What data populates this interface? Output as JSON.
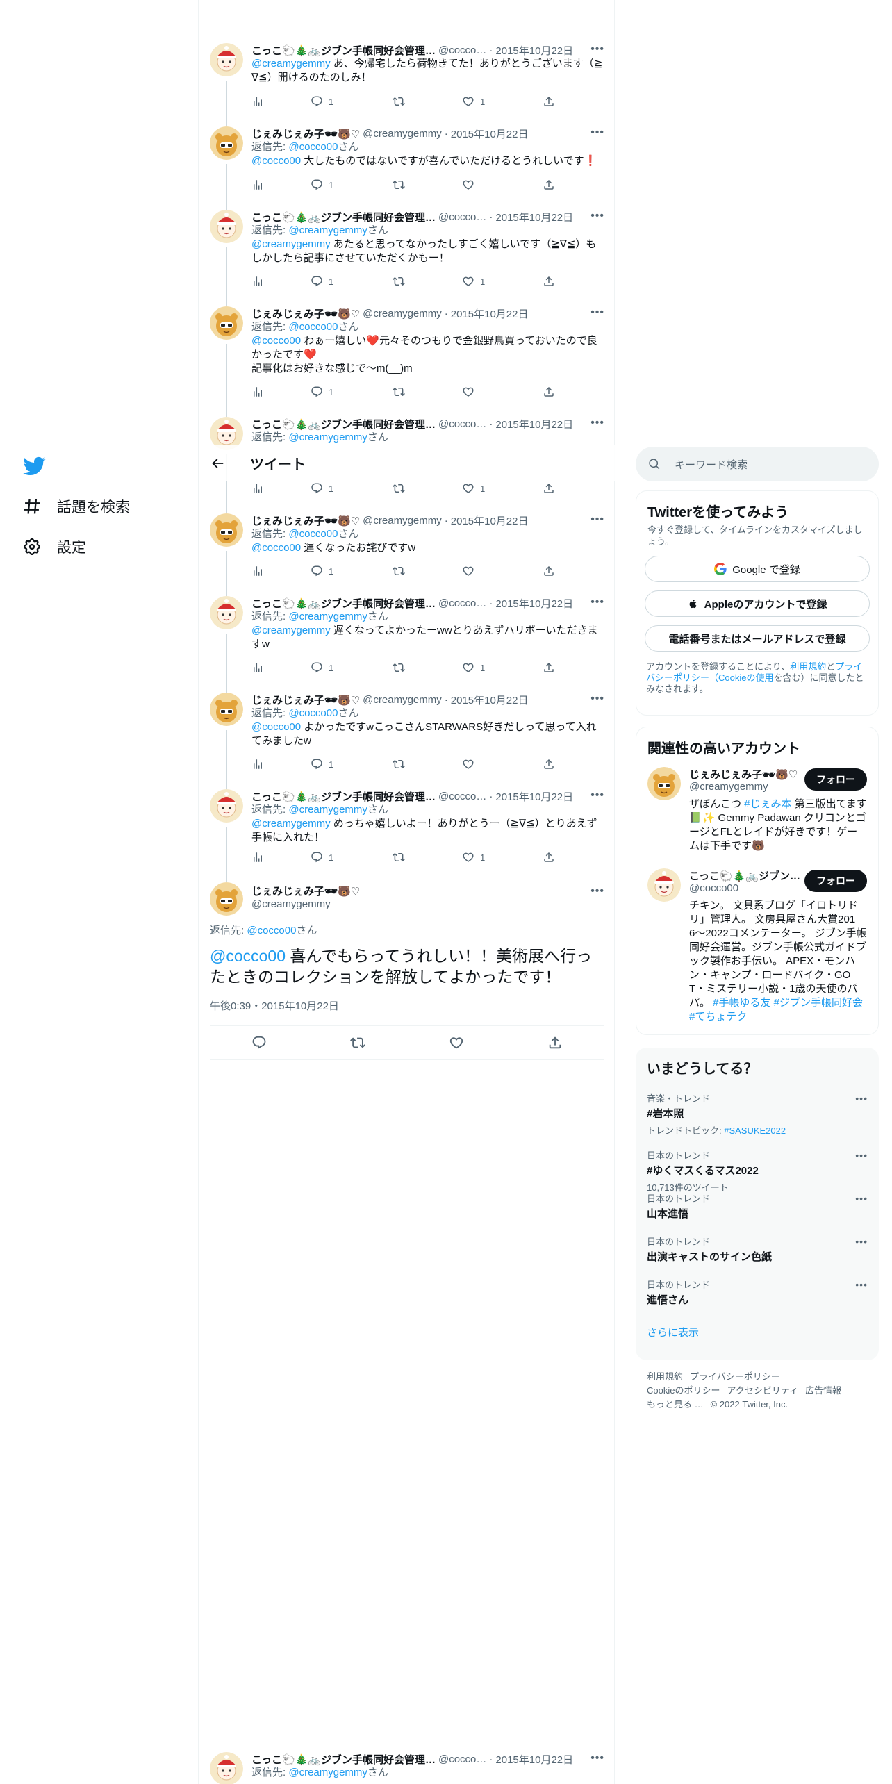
{
  "nav": {
    "explore": "話題を検索",
    "settings": "設定"
  },
  "header": {
    "title": "ツイート"
  },
  "tweets": [
    {
      "name": "こっこ🐑🎄🚲ジブン手帳同好会管理…",
      "handle": "@cocco…",
      "date": "2015年10月22日",
      "reply_to": "",
      "text_mention": "@creamygemmy",
      "text": " あ、今帰宅したら荷物きてた！ありがとうございます（≧∇≦）開けるのたのしみ！",
      "replies": "1",
      "likes": "1"
    },
    {
      "name": "じぇみじぇみ子🕶🐻♡",
      "handle": "@creamygemmy",
      "date": "2015年10月22日",
      "reply_to": "@cocco00",
      "text_mention": "@cocco00",
      "text": " 大したものではないですが喜んでいただけるとうれしいです❗",
      "replies": "1",
      "likes": ""
    },
    {
      "name": "こっこ🐑🎄🚲ジブン手帳同好会管理…",
      "handle": "@cocco…",
      "date": "2015年10月22日",
      "reply_to": "@creamygemmy",
      "text_mention": "@creamygemmy",
      "text": " あたると思ってなかったしすごく嬉しいです（≧∇≦）もしかしたら記事にさせていただくかもー！",
      "replies": "1",
      "likes": "1"
    },
    {
      "name": "じぇみじぇみ子🕶🐻♡",
      "handle": "@creamygemmy",
      "date": "2015年10月22日",
      "reply_to": "@cocco00",
      "text_mention": "@cocco00",
      "text": " わぁー嬉しい❤️元々そのつもりで金銀野鳥買っておいたので良かったです❤️\n記事化はお好きな感じで～m(__)m",
      "replies": "1",
      "likes": ""
    },
    {
      "name": "こっこ🐑🎄🚲ジブン手帳同好会管理…",
      "handle": "@cocco…",
      "date": "2015年10月22日",
      "reply_to": "@creamygemmy",
      "text_mention": "",
      "text": "",
      "replies": "1",
      "likes": "1"
    },
    {
      "name": "じぇみじぇみ子🕶🐻♡",
      "handle": "@creamygemmy",
      "date": "2015年10月22日",
      "reply_to": "@cocco00",
      "text_mention": "@cocco00",
      "text": " 遅くなったお詫びですw",
      "replies": "1",
      "likes": ""
    },
    {
      "name": "こっこ🐑🎄🚲ジブン手帳同好会管理…",
      "handle": "@cocco…",
      "date": "2015年10月22日",
      "reply_to": "@creamygemmy",
      "text_mention": "@creamygemmy",
      "text": " 遅くなってよかったーwwとりあえずハリポーいただきますw",
      "replies": "1",
      "likes": "1"
    },
    {
      "name": "じぇみじぇみ子🕶🐻♡",
      "handle": "@creamygemmy",
      "date": "2015年10月22日",
      "reply_to": "@cocco00",
      "text_mention": "@cocco00",
      "text": " よかったですwこっこさんSTARWARS好きだしって思って入れてみましたw",
      "replies": "1",
      "likes": ""
    },
    {
      "name": "こっこ🐑🎄🚲ジブン手帳同好会管理…",
      "handle": "@cocco…",
      "date": "2015年10月22日",
      "reply_to": "@creamygemmy",
      "text_mention": "@creamygemmy",
      "text": " めっちゃ嬉しいよー！ありがとうー（≧∇≦）とりあえず手帳に入れた！",
      "replies": "1",
      "likes": "1"
    }
  ],
  "reply_prefix": "返信先: ",
  "reply_suffix": "さん",
  "main_tweet": {
    "name": "じぇみじぇみ子🕶🐻♡",
    "handle": "@creamygemmy",
    "reply_to": "@cocco00",
    "text_mention": "@cocco00",
    "text": " 喜んでもらってうれしい！！美術展へ行ったときのコレクションを解放してよかったです！",
    "datetime": "午後0:39・2015年10月22日"
  },
  "bottom_tweet": {
    "name": "こっこ🐑🎄🚲ジブン手帳同好会管理…",
    "handle": "@cocco…",
    "date": "2015年10月22日",
    "reply_to": "@creamygemmy"
  },
  "search": {
    "placeholder": "キーワード検索"
  },
  "signup": {
    "title": "Twitterを使ってみよう",
    "subtitle": "今すぐ登録して、タイムラインをカスタマイズしましょう。",
    "google": "Google で登録",
    "apple": "Appleのアカウントで登録",
    "phone": "電話番号またはメールアドレスで登録",
    "legal_1": "アカウントを登録することにより、",
    "legal_terms": "利用規約",
    "legal_2": "と",
    "legal_privacy": "プライバシーポリシー（Cookieの使用",
    "legal_3": "を含む）に同意したとみなされます。"
  },
  "who_to_follow": {
    "title": "関連性の高いアカウント",
    "follow_label": "フォロー",
    "accounts": [
      {
        "name": "じぇみじぇみ子🕶🐻♡",
        "handle": "@creamygemmy",
        "bio_1": "ザぼんこつ ",
        "bio_tag": "#じぇみ本",
        "bio_2": " 第三版出てます📗✨ Gemmy Padawan クリコンとゴージとFLとレイドが好きです！ゲームは下手です🐻"
      },
      {
        "name": "こっこ🐑🎄🚲ジブン手帳同好会管理…",
        "handle": "@cocco00",
        "bio_1": "チキン。 文具系ブログ「イロトリドリ」管理人。 文房具屋さん大賞2016〜2022コメンテーター。 ジブン手帳同好会運営。ジブン手帳公式ガイドブック製作お手伝い。 APEX・モンハン・キャンプ・ロードバイク・GOT・ミステリー小説・1歳の天使のパパ。 ",
        "bio_tag": "#手帳ゆる友 #ジブン手帳同好会 #てちょテク",
        "bio_2": ""
      }
    ]
  },
  "trends": {
    "title": "いまどうしてる？",
    "items": [
      {
        "meta": "音楽・トレンド",
        "name": "#岩本照",
        "sub_label": "トレンドトピック: ",
        "sub_tag": "#SASUKE2022"
      },
      {
        "meta": "日本のトレンド",
        "name": "#ゆくマスくるマス2022",
        "sub_label": "10,713件のツイート",
        "sub_tag": ""
      },
      {
        "meta": "日本のトレンド",
        "name": "山本進悟",
        "sub_label": "",
        "sub_tag": ""
      },
      {
        "meta": "日本のトレンド",
        "name": "出演キャストのサイン色紙",
        "sub_label": "",
        "sub_tag": ""
      },
      {
        "meta": "日本のトレンド",
        "name": "進悟さん",
        "sub_label": "",
        "sub_tag": ""
      }
    ],
    "show_more": "さらに表示"
  },
  "footer": {
    "links": [
      "利用規約",
      "プライバシーポリシー",
      "Cookieのポリシー",
      "アクセシビリティ",
      "広告情報",
      "もっと見る …"
    ],
    "copyright": "© 2022 Twitter, Inc."
  },
  "colors": {
    "accent": "#1d9bf0",
    "text": "#0f1419",
    "muted": "#536471",
    "like_red": "#e0245e"
  },
  "icons": [
    "twitter-bird-icon",
    "hashtag-icon",
    "gear-icon",
    "back-arrow-icon",
    "search-icon",
    "reply-icon",
    "retweet-icon",
    "like-icon",
    "share-icon",
    "analytics-icon",
    "more-icon",
    "google-icon",
    "apple-icon"
  ]
}
